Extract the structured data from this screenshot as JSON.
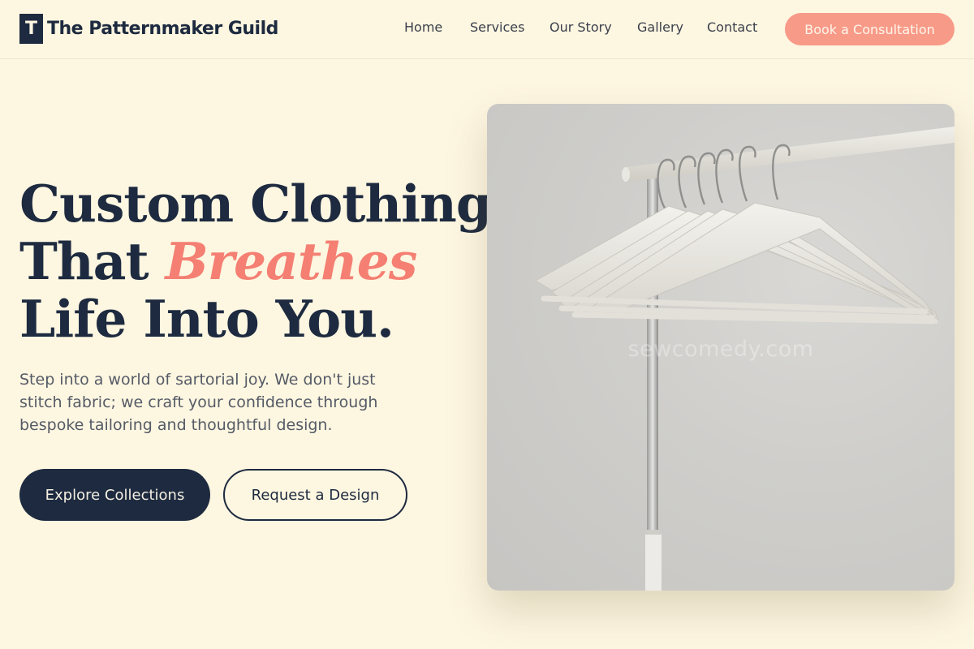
{
  "brand": {
    "mark": "T",
    "name": "The Patternmaker Guild"
  },
  "nav": {
    "items": [
      "Home",
      "Services",
      "Our Story",
      "Gallery",
      "Contact"
    ],
    "cta": "Book a Consultation"
  },
  "hero": {
    "headline": {
      "line1": "Custom Clothing",
      "line2_before": "That",
      "line2_accent": "Breathes",
      "line3": "Life Into You."
    },
    "lead": "Step into a world of sartorial joy. We don't just stitch fabric; we craft your confidence through bespoke tailoring and thoughtful design.",
    "primary_button": "Explore Collections",
    "secondary_button": "Request a Design",
    "image_watermark": "sewcomedy.com"
  },
  "colors": {
    "background": "#fdf6e1",
    "navy": "#1d2a3f",
    "coral": "#f47f72",
    "cta_coral": "#f89a88"
  },
  "icons": {
    "brand_mark": "letter-t-logo"
  }
}
